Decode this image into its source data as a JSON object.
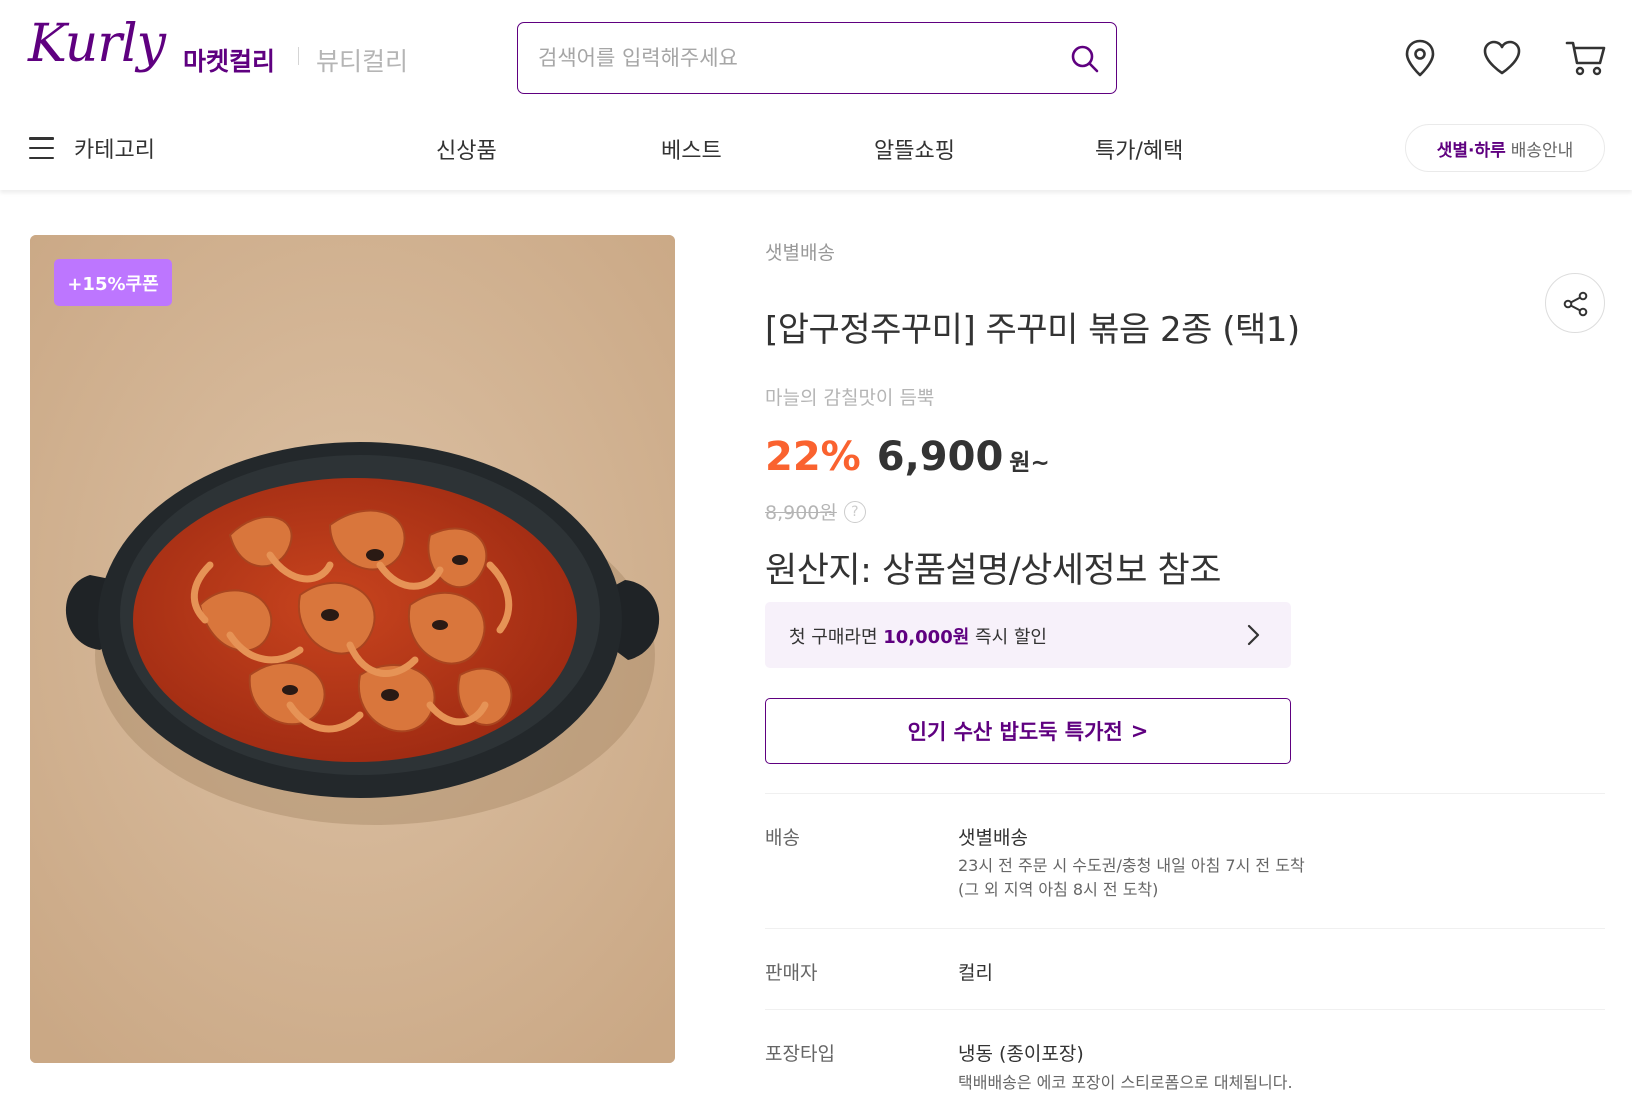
{
  "header": {
    "logo": "Kurly",
    "service_market": "마켓컬리",
    "service_beauty": "뷰티컬리",
    "search_placeholder": "검색어를 입력해주세요",
    "icons": [
      "location-pin-icon",
      "heart-icon",
      "cart-icon"
    ]
  },
  "nav": {
    "category_label": "카테고리",
    "items": [
      "신상품",
      "베스트",
      "알뜰쇼핑",
      "특가/혜택"
    ],
    "delivery_strong": "샛별·하루",
    "delivery_rest": "배송안내"
  },
  "product": {
    "coupon_badge": "+15%쿠폰",
    "delivery_type": "샛별배송",
    "title": "[압구정주꾸미] 주꾸미 볶음 2종 (택1)",
    "subtitle": "마늘의 감칠맛이 듬뿍",
    "discount": "22%",
    "price": "6,900",
    "price_unit": "원~",
    "original_price": "8,900원",
    "origin": "원산지: 상품설명/상세정보 참조",
    "first_purchase_prefix": "첫 구매라면",
    "first_purchase_amount": "10,000원",
    "first_purchase_suffix": "즉시 할인",
    "promo_button": "인기 수산 밥도둑 특가전",
    "promo_arrow": ">"
  },
  "details": {
    "delivery_label": "배송",
    "delivery_value": "샛별배송",
    "delivery_note_1": "23시 전 주문 시 수도권/충청 내일 아침 7시 전 도착",
    "delivery_note_2": "(그 외 지역 아침 8시 전 도착)",
    "seller_label": "판매자",
    "seller_value": "컬리",
    "package_label": "포장타입",
    "package_value": "냉동 (종이포장)",
    "package_note": "택배배송은 에코 포장이 스티로폼으로 대체됩니다."
  },
  "colors": {
    "brand": "#5f0080",
    "discount": "#fa622f",
    "coupon": "#bd76ff"
  }
}
